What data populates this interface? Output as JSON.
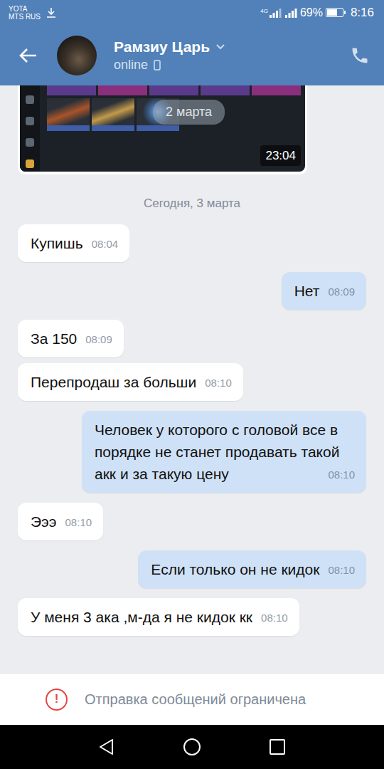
{
  "status_bar": {
    "carrier_1": "YOTA",
    "carrier_2": "MTS RUS",
    "network": "4G",
    "battery": "69%",
    "battery_level": 0.69,
    "time": "8:16"
  },
  "header": {
    "name": "Рамзиу Царь",
    "status": "online"
  },
  "attachment": {
    "date_overlay": "2 марта",
    "time": "23:04"
  },
  "date_divider": "Сегодня, 3 марта",
  "messages": [
    {
      "text": "Купишь",
      "time": "08:04",
      "kind": "incoming"
    },
    {
      "text": "Нет",
      "time": "08:09",
      "kind": "outgoing"
    },
    {
      "text": "За 150",
      "time": "08:09",
      "kind": "incoming"
    },
    {
      "text": "Перепродаш за больши",
      "time": "08:10",
      "kind": "incoming"
    },
    {
      "text": "Человек у которого с головой все в порядке не станет продавать такой акк и за такую цену",
      "time": "08:10",
      "kind": "outgoing"
    },
    {
      "text": "Эээ",
      "time": "08:10",
      "kind": "incoming"
    },
    {
      "text": "Если только он не кидок",
      "time": "08:10",
      "kind": "outgoing"
    },
    {
      "text": "У меня 3 ака ,м-да я не кидок кк",
      "time": "08:10",
      "kind": "incoming"
    }
  ],
  "footer": {
    "icon": "!",
    "notice": "Отправка сообщений ограничена"
  }
}
